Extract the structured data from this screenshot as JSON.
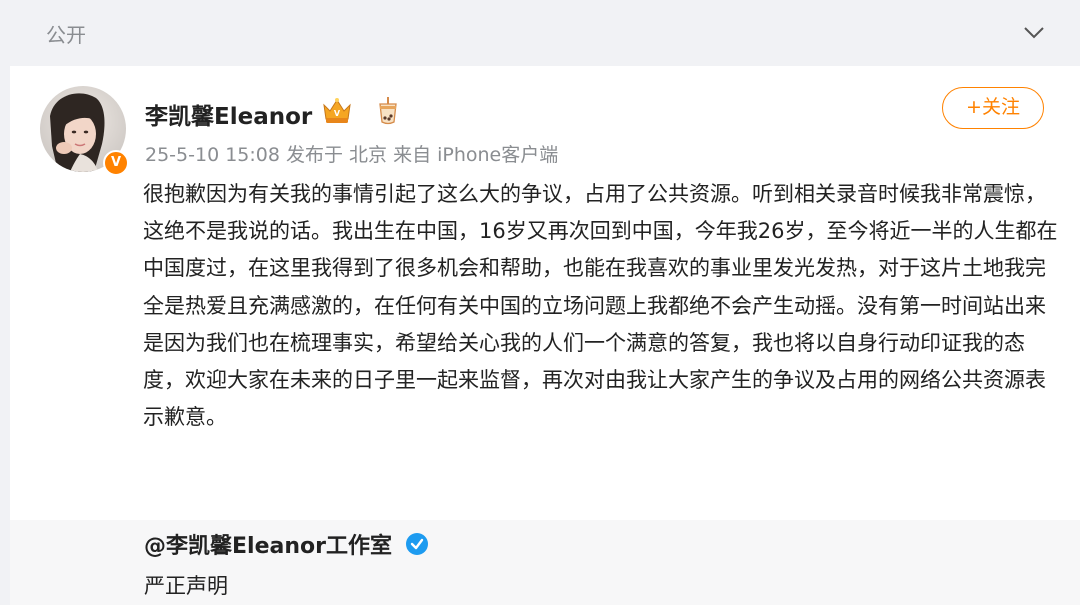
{
  "header": {
    "visibility_label": "公开",
    "collapse_icon": "chevron-down-icon"
  },
  "post": {
    "author": "李凯馨Eleanor",
    "badges": [
      "vip-crown-icon",
      "bubble-tea-icon"
    ],
    "verified_badge": "V",
    "meta": "25-5-10 15:08 发布于 北京 来自 iPhone客户端",
    "follow_label": "+关注",
    "content": "很抱歉因为有关我的事情引起了这么大的争议，占用了公共资源。听到相关录音时候我非常震惊，这绝不是我说的话。我出生在中国，16岁又再次回到中国，今年我26岁，至今将近一半的人生都在中国度过，在这里我得到了很多机会和帮助，也能在我喜欢的事业里发光发热，对于这片土地我完全是热爱且充满感激的，在任何有关中国的立场问题上我都绝不会产生动摇。没有第一时间站出来是因为我们也在梳理事实，希望给关心我的人们一个满意的答复，我也将以自身行动印证我的态度，欢迎大家在未来的日子里一起来监督，再次对由我让大家产生的争议及占用的网络公共资源表示歉意。"
  },
  "repost": {
    "author": "@李凯馨Eleanor工作室",
    "text": "严正声明"
  },
  "colors": {
    "accent": "#ff8200",
    "verified_blue": "#1d9bf0",
    "meta_gray": "#8a8d91"
  }
}
